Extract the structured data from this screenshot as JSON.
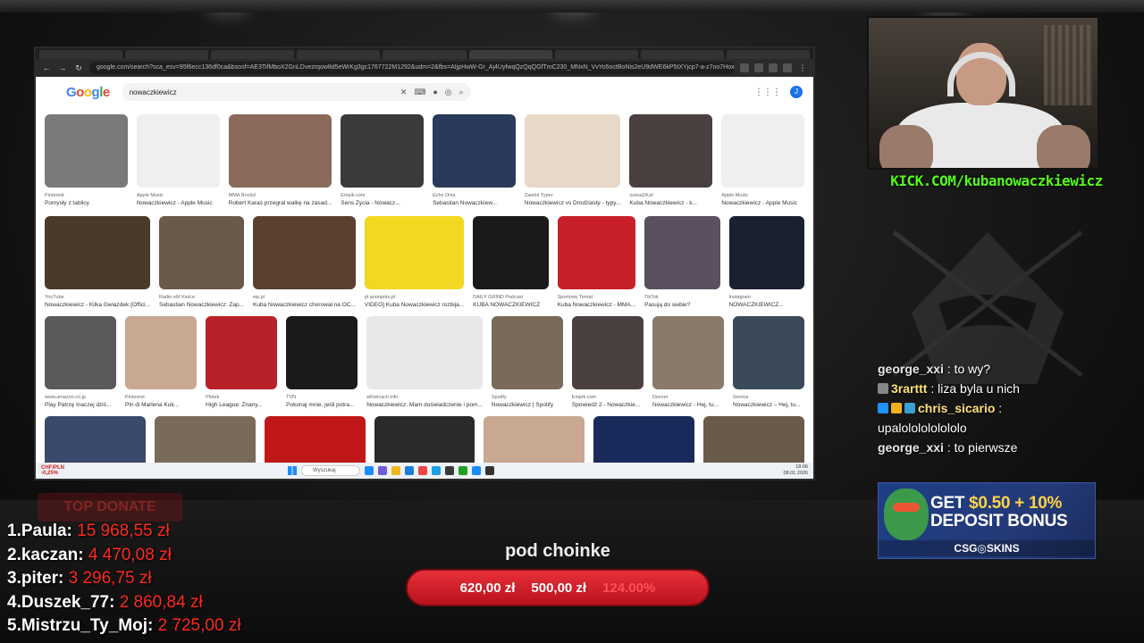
{
  "browser": {
    "tabs": [
      "",
      "",
      "",
      "",
      "",
      "",
      "",
      "",
      ""
    ],
    "url": "google.com/search?sca_esv=95f6ecc136df0ca&bsosf=AE3TifMboX2GnLDvezrqow8d5eWrKg3gc1767722M1292&udm=2&fbs=AIjpHwW-Gr_Aj4UyfwqQzQqQGfTmC230_MNxN_VvYo5octBoNis2eU9dWE6kP5tXYjcp7-a-z7no7Hoxqy9ET...",
    "search_query": "nowaczkiewicz",
    "account_initial": "J",
    "google_letters": [
      "G",
      "o",
      "o",
      "g",
      "l",
      "e"
    ]
  },
  "images": {
    "row1": [
      {
        "source": "Pinterest",
        "title": "Pomysły z tablicy",
        "color": "#7a7a7a"
      },
      {
        "source": "Apple Music",
        "title": "Nowaczkiewicz - Apple Music",
        "color": "#efefef"
      },
      {
        "source": "MMA Rocks!",
        "title": "Robert Karaś przegrał walkę na zasad...",
        "color": "#8a6a5a"
      },
      {
        "source": "Empik.com",
        "title": "Sens Życia - Nowacz...",
        "color": "#3a3a3a"
      },
      {
        "source": "Echo Dnia",
        "title": "Sebastian Nowaczkiew...",
        "color": "#2a3a5a"
      },
      {
        "source": "Zawód Typer",
        "title": "Nowaczkiewicz vs Drodżiasty - typy...",
        "color": "#e8d8c8"
      },
      {
        "source": "szesa24.pl",
        "title": "Kuba Nowaczkiewicz - k...",
        "color": "#4a4040"
      },
      {
        "source": "Apple Music",
        "title": "Nowaczkiewicz - Apple Music",
        "color": "#efefef"
      }
    ],
    "row2": [
      {
        "source": "YouTube",
        "title": "Nowaczkiewicz - Kilka Gwiazdek [Offici...",
        "color": "#4a3a2a"
      },
      {
        "source": "Radio eM Kielce",
        "title": "Sebastian Nowaczkiewicz: Zap...",
        "color": "#6a5a4a"
      },
      {
        "source": "wp.pl",
        "title": "Kuba Nowaczkiewicz chorował na OC...",
        "color": "#5a4030"
      },
      {
        "source": "pl.anonpotu.pl",
        "title": "VIDEO] Kuba Nowaczkiewicz rozbija...",
        "color": "#f2d820"
      },
      {
        "source": "DAILY GRIND Podcast",
        "title": "KUBA NOWACZKIEWICZ",
        "color": "#1a1a1a"
      },
      {
        "source": "Sportowy Temat",
        "title": "Kuba Nowaczkiewicz - MMA...",
        "color": "#c8202a"
      },
      {
        "source": "TikTok",
        "title": "Pasują do siebie?",
        "color": "#5a5060"
      },
      {
        "source": "Instagram",
        "title": "NOWACZKIEWICZ...",
        "color": "#1a2030"
      }
    ],
    "row3": [
      {
        "source": "www.amazon.co.jp",
        "title": "Play Patrzę Inaczej dziś...",
        "color": "#5a5a5a"
      },
      {
        "source": "Pinterest",
        "title": "Pin di Marlena Kuk...",
        "color": "#c8a890"
      },
      {
        "source": "Plotek",
        "title": "High League: Znany...",
        "color": "#b8202a"
      },
      {
        "source": "TVN",
        "title": "Pokonaj mnie, jeśli potra...",
        "color": "#1a1a1a"
      },
      {
        "source": "wKielcach.info",
        "title": "Nowaczkiewicz: Mam doświadczenie i pom...",
        "color": "#e8e8e8"
      },
      {
        "source": "Spotify",
        "title": "Nowaczkiewicz | Spotify",
        "color": "#7a6a5a"
      },
      {
        "source": "Empik.com",
        "title": "Spowiedź 2 - Nowaczkie...",
        "color": "#4a4040"
      },
      {
        "source": "Deezer",
        "title": "Nowaczkiewicz - Hej, tu...",
        "color": "#8a7a6a"
      },
      {
        "source": "Genius",
        "title": "Nowaczkiewicz – Hej, tu...",
        "color": "#3a4a5a"
      }
    ],
    "row4": [
      {
        "color": "#3a4a6a"
      },
      {
        "color": "#7a6a5a"
      },
      {
        "color": "#c01818"
      },
      {
        "color": "#2a2a2a"
      },
      {
        "color": "#c8a890"
      },
      {
        "color": "#1a2a5a"
      },
      {
        "color": "#6a5a4a"
      }
    ]
  },
  "taskbar": {
    "ticker": "CHF/PLN",
    "ticker_change": "-0,25%",
    "search_placeholder": "Wyszukaj",
    "time": "18:06",
    "date": "08.01.2026",
    "apps": [
      "#1b8cff",
      "#6f5cd6",
      "#f2b71c",
      "#1a7fd8",
      "#e44",
      "#1a9fe8",
      "#3a3a3a",
      "#20a020",
      "#1b8cff",
      "#333"
    ]
  },
  "stream": {
    "kick_url": "KICK.COM/kubanowaczkiewicz"
  },
  "chat": [
    {
      "user": "george_xxi",
      "message": "to wy?",
      "badges": []
    },
    {
      "user": "3rarttt",
      "message": "liza byla u nich",
      "badges": [
        "#888"
      ]
    },
    {
      "user": "chris_sicario",
      "message": "upalololololololo",
      "badges": [
        "#1e90ff",
        "#f0b020",
        "#3aa0d0"
      ]
    },
    {
      "user": "george_xxi",
      "message": "to pierwsze",
      "badges": []
    }
  ],
  "ad": {
    "line1_prefix": "GET",
    "line1_value": "$0.50 + 10%",
    "line2": "DEPOSIT BONUS",
    "brand": "CSG◎SKINS"
  },
  "top_donate": {
    "label": "TOP DONATE",
    "donors": [
      {
        "rank": "1.",
        "name": "Paula:",
        "amount": "15 968,55 zł"
      },
      {
        "rank": "2.",
        "name": "kaczan:",
        "amount": "4 470,08 zł"
      },
      {
        "rank": "3.",
        "name": "piter:",
        "amount": "3 296,75 zł"
      },
      {
        "rank": "4.",
        "name": "Duszek_77:",
        "amount": "2 860,84 zł"
      },
      {
        "rank": "5.",
        "name": "Mistrzu_Ty_Moj:",
        "amount": "2 725,00 zł"
      }
    ]
  },
  "goal": {
    "title": "pod choinke",
    "current": "620,00 zł",
    "target": "500,00 zł",
    "percent": "124.00%"
  }
}
